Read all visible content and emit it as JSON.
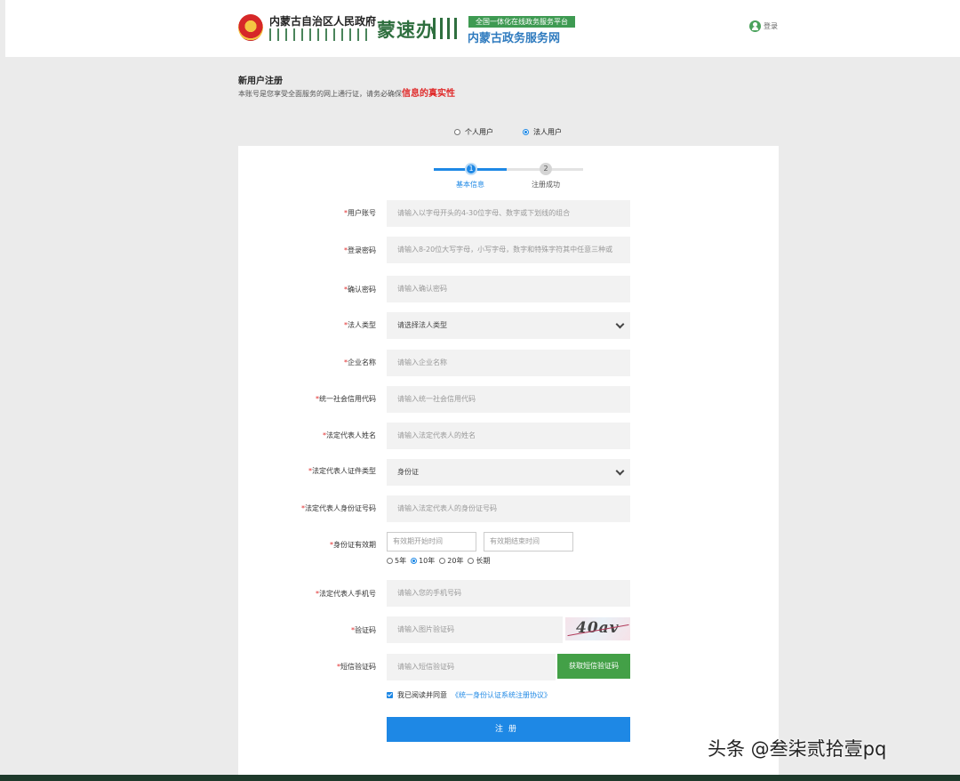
{
  "header": {
    "gov_name": "内蒙古自治区人民政府",
    "brand_calligraphy": "蒙速办",
    "platform_badge": "全国一体化在线政务服务平台",
    "platform_name": "内蒙古政务服务网",
    "login_label": "登录"
  },
  "register": {
    "title": "新用户注册",
    "note": "本账号是您享受全面服务的网上通行证，请务必确保",
    "note_emphasis": "信息的真实性"
  },
  "user_types": [
    {
      "label": "个人用户",
      "selected": false
    },
    {
      "label": "法人用户",
      "selected": true
    }
  ],
  "steps": [
    {
      "number": "1",
      "label": "基本信息",
      "active": true
    },
    {
      "number": "2",
      "label": "注册成功",
      "active": false
    }
  ],
  "form": {
    "required_mark": "*",
    "fields": [
      {
        "label": "用户账号",
        "placeholder": "请输入以字母开头的4-30位字母、数字或下划线的组合",
        "type": "text"
      },
      {
        "label": "登录密码",
        "placeholder": "请输入8-20位大写字母，小写字母，数字和特殊字符其中任意三种或",
        "type": "text"
      },
      {
        "label": "确认密码",
        "placeholder": "请输入确认密码",
        "type": "text"
      },
      {
        "label": "法人类型",
        "value": "请选择法人类型",
        "type": "select"
      },
      {
        "label": "企业名称",
        "placeholder": "请输入企业名称",
        "type": "text"
      },
      {
        "label": "统一社会信用代码",
        "placeholder": "请输入统一社会信用代码",
        "type": "text"
      },
      {
        "label": "法定代表人姓名",
        "placeholder": "请输入法定代表人的姓名",
        "type": "text"
      },
      {
        "label": "法定代表人证件类型",
        "value": "身份证",
        "type": "select"
      },
      {
        "label": "法定代表人身份证号码",
        "placeholder": "请输入法定代表人的身份证号码",
        "type": "text"
      }
    ],
    "validity": {
      "label": "身份证有效期",
      "start_placeholder": "有效期开始时间",
      "end_placeholder": "有效期结束时间",
      "options": [
        {
          "label": "5年",
          "selected": false
        },
        {
          "label": "10年",
          "selected": true
        },
        {
          "label": "20年",
          "selected": false
        },
        {
          "label": "长期",
          "selected": false
        }
      ]
    },
    "phone": {
      "label": "法定代表人手机号",
      "placeholder": "请输入您的手机号码"
    },
    "captcha": {
      "label": "验证码",
      "placeholder": "请输入图片验证码",
      "image_text": "40av"
    },
    "sms": {
      "label": "短信验证码",
      "placeholder": "请输入短信验证码",
      "button": "获取短信验证码"
    },
    "agreement": {
      "text": "我已阅读并同意",
      "link": "《统一身份认证系统注册协议》",
      "checked": true
    },
    "submit": "注册"
  },
  "watermark": "头条 @叁柒贰拾壹pq"
}
